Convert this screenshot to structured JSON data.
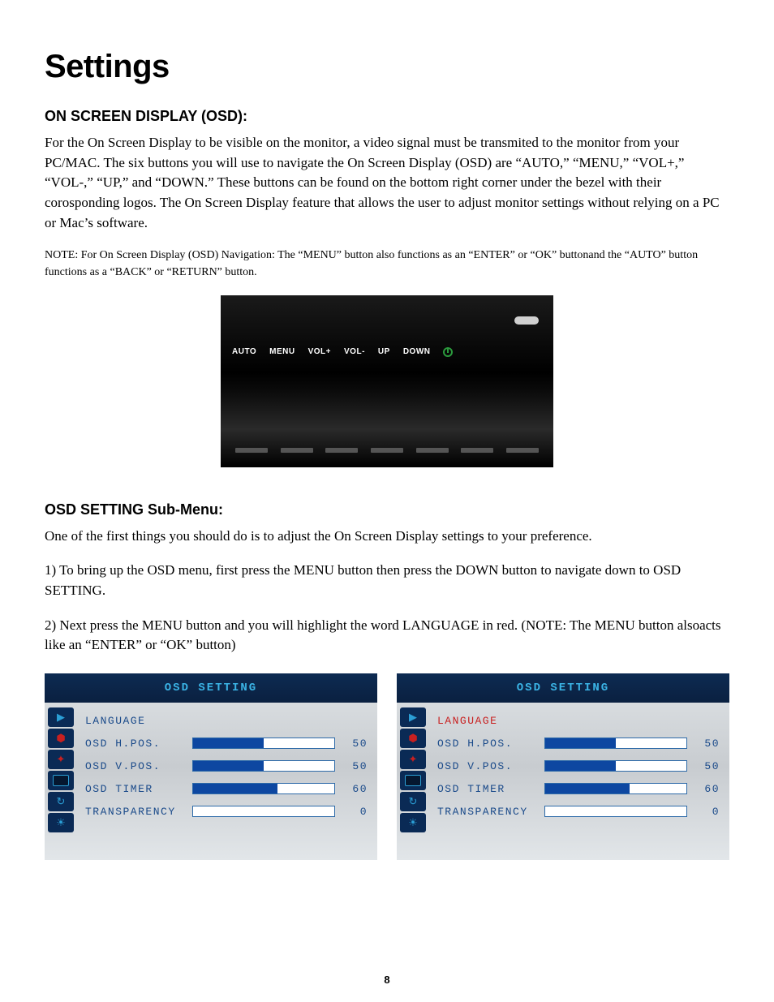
{
  "page": {
    "title": "Settings",
    "number": "8"
  },
  "section1": {
    "heading": "ON SCREEN DISPLAY (OSD):",
    "body": "For the On Screen Display to be visible on the monitor, a video signal must be transmited to the monitor from your PC/MAC.  The six buttons you will use to navigate the On Screen Display (OSD) are “AUTO,” “MENU,” “VOL+,” “VOL-,” “UP,” and “DOWN.” These buttons can be found on the bottom right corner under the bezel with their corosponding logos.  The On Screen Display feature that allows the user to adjust monitor settings without relying on a PC or Mac’s software.",
    "note": "NOTE: For On Screen Display (OSD) Navigation: The “MENU” button also functions as an “ENTER” or “OK” buttonand the “AUTO” button functions as a “BACK” or “RETURN” button."
  },
  "bezel": {
    "auto": "AUTO",
    "menu": "MENU",
    "volp": "VOL+",
    "volm": "VOL-",
    "up": "UP",
    "down": "DOWN"
  },
  "section2": {
    "heading": "OSD SETTING Sub-Menu:",
    "p1": "One of the first things you should do is to adjust the On Screen Display settings to your preference.",
    "p2": "1) To bring up the OSD menu, first press the MENU button then press the DOWN button to navigate down to OSD SETTING.",
    "p3": "2) Next press the MENU button and you will highlight the word LANGUAGE in red. (NOTE: The MENU button alsoacts like an “ENTER” or “OK” button)"
  },
  "osd": {
    "title": "OSD SETTING",
    "items": [
      {
        "label": "LANGUAGE",
        "val": "",
        "fill": 0
      },
      {
        "label": "OSD H.POS.",
        "val": "50",
        "fill": 50
      },
      {
        "label": "OSD V.POS.",
        "val": "50",
        "fill": 50
      },
      {
        "label": "OSD TIMER",
        "val": "60",
        "fill": 60
      },
      {
        "label": "TRANSPARENCY",
        "val": "0",
        "fill": 0
      }
    ]
  }
}
